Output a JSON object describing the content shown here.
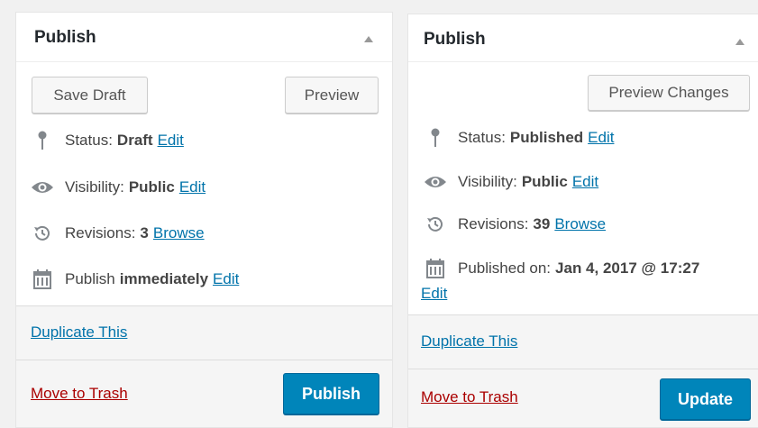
{
  "left": {
    "title": "Publish",
    "save_draft": "Save Draft",
    "preview": "Preview",
    "status_label": "Status:",
    "status_value": "Draft",
    "status_edit": "Edit",
    "visibility_label": "Visibility:",
    "visibility_value": "Public",
    "visibility_edit": "Edit",
    "revisions_label": "Revisions:",
    "revisions_value": "3",
    "revisions_browse": "Browse",
    "publish_label": "Publish",
    "publish_value": "immediately",
    "publish_edit": "Edit",
    "duplicate": "Duplicate This",
    "trash": "Move to Trash",
    "primary": "Publish"
  },
  "right": {
    "title": "Publish",
    "preview": "Preview Changes",
    "status_label": "Status:",
    "status_value": "Published",
    "status_edit": "Edit",
    "visibility_label": "Visibility:",
    "visibility_value": "Public",
    "visibility_edit": "Edit",
    "revisions_label": "Revisions:",
    "revisions_value": "39",
    "revisions_browse": "Browse",
    "published_label": "Published on:",
    "published_value": "Jan 4, 2017 @ 17:27",
    "published_edit": "Edit",
    "duplicate": "Duplicate This",
    "trash": "Move to Trash",
    "primary": "Update"
  },
  "colors": {
    "link": "#0073aa",
    "trash": "#a00",
    "primary": "#0085ba"
  }
}
